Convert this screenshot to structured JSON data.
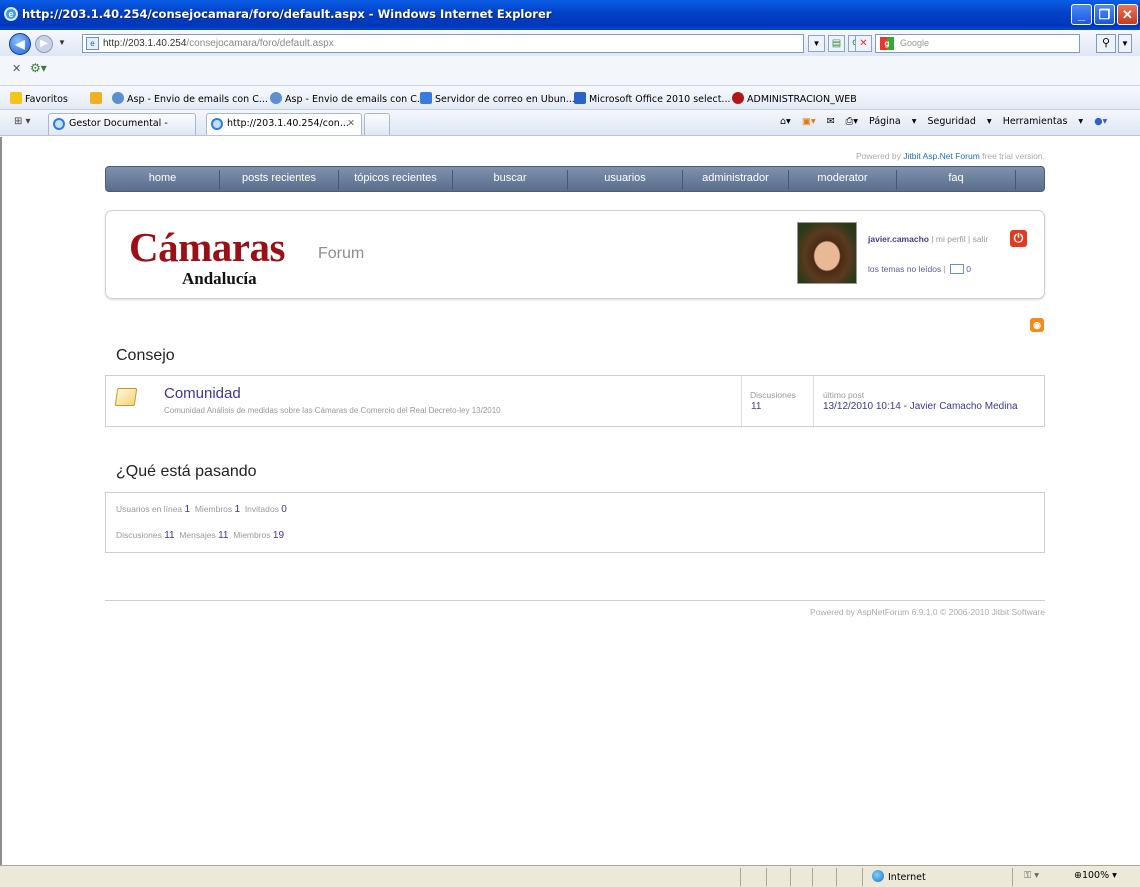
{
  "browser": {
    "window_title": "http://203.1.40.254/consejocamara/foro/default.aspx - Windows Internet Explorer",
    "address": {
      "host": "http://203.1.40.254",
      "path": "/consejocamara/foro/default.aspx"
    },
    "search_placeholder": "Google",
    "favorites_label": "Favoritos",
    "favorites": [
      "Asp - Envio de emails con C...",
      "Asp - Envio de emails con C...",
      "Servidor de correo en Ubun...",
      "Microsoft Office 2010 select...",
      "ADMINISTRACION_WEB"
    ],
    "tabs": [
      "Gestor Documental -",
      "http://203.1.40.254/con..."
    ],
    "commands": {
      "page": "Página",
      "security": "Seguridad",
      "tools": "Herramientas"
    },
    "status": {
      "zone": "Internet",
      "zoom": "100%"
    }
  },
  "forum": {
    "powered_top": {
      "prefix": "Powered by",
      "link": "Jitbit Asp.Net Forum",
      "suffix": "free trial version."
    },
    "menu": [
      "home",
      "posts recientes",
      "tópicos recientes",
      "buscar",
      "usuarios",
      "administrador",
      "moderator",
      "faq"
    ],
    "logo": {
      "main": "Cámaras",
      "sub": "Andalucía",
      "forum_word": "Forum"
    },
    "user": {
      "name": "javier.camacho",
      "profile_link": "mi perfil",
      "logout_link": "salir",
      "unread_link": "los temas no leídos",
      "messages_count": "0"
    },
    "section_title": "Consejo",
    "forums": [
      {
        "title": "Comunidad",
        "description": "Comunidad Análisis de medidas sobre las Cámaras de Comercio del Real Decreto-ley 13/2010",
        "discussions_label": "Discusiones",
        "discussions": "11",
        "last_post_label": "último post",
        "last_post": "13/12/2010 10:14 - Javier Camacho Medina"
      }
    ],
    "whats_happening": {
      "title": "¿Qué está pasando",
      "online_label": "Usuarios en línea",
      "online": "1",
      "members_label": "Miembros",
      "members_online": "1",
      "guests_label": "Invitados",
      "guests": "0",
      "discussions_label": "Discusiones",
      "discussions": "11",
      "messages_label": "Mensajes",
      "messages": "11",
      "members_total_label": "Miembros",
      "members_total": "19"
    },
    "powered_bottom": "Powered by AspNetForum 6.9.1.0 © 2006-2010 Jitbit Software"
  }
}
